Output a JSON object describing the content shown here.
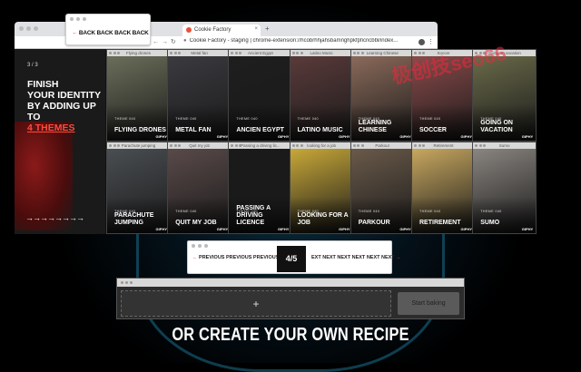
{
  "browser": {
    "tab_title": "Cookie Factory",
    "url": "Cookie Factory - staging | chrome-extension://hcobrhhjahsbamnghpkfpficncbbl/index...",
    "new_tab": "+",
    "tab_close": "×"
  },
  "back_window": {
    "label": "BACK BACK BACK BACK",
    "arrow": "←"
  },
  "intro": {
    "count": "3 / 3",
    "heading_line1": "FINISH",
    "heading_line2": "YOUR IDENTITY",
    "heading_line3": "BY ADDING UP",
    "heading_line4": "TO",
    "heading_accent": "4 THEMES",
    "arrows": "→→→→→→→→"
  },
  "tiles": [
    {
      "header": "Flying drones",
      "theme": "THEME 040",
      "name": "FLYING DRONES",
      "giphy": "GIPHY",
      "color": "#6b6e5a"
    },
    {
      "header": "Metal fan",
      "theme": "THEME 040",
      "name": "METAL FAN",
      "giphy": "GIPHY",
      "color": "#3b3a3f"
    },
    {
      "header": "Ancient Egypt",
      "theme": "THEME 040",
      "name": "ANCIEN EGYPT",
      "giphy": "GIPHY",
      "color": "#1e1e1e"
    },
    {
      "header": "Latino Music",
      "theme": "THEME 040",
      "name": "LATINO MUSIC",
      "giphy": "GIPHY",
      "color": "#5a3a3a"
    },
    {
      "header": "Learning Chinese",
      "theme": "THEME 040",
      "name": "LEARNING CHINESE",
      "giphy": "GIPHY",
      "color": "#8a6a5a"
    },
    {
      "header": "Soccer",
      "theme": "THEME 040",
      "name": "SOCCER",
      "giphy": "GIPHY",
      "color": "#8a4a4a"
    },
    {
      "header": "Going on vacation",
      "theme": "THEME 040",
      "name": "GOING ON VACATION",
      "giphy": "GIPHY",
      "color": "#6a6a4a"
    },
    {
      "header": "Parachute jumping",
      "theme": "THEME 040",
      "name": "PARACHUTE JUMPING",
      "giphy": "GIPHY",
      "color": "#4a4e52"
    },
    {
      "header": "Quit my job",
      "theme": "THEME 040",
      "name": "QUIT MY JOB",
      "giphy": "GIPHY",
      "color": "#5a4a4a"
    },
    {
      "header": "Passing a driving lic...",
      "theme": "THEME 040",
      "name": "PASSING A DRIVING LICENCE",
      "giphy": "GIPHY",
      "color": "#1a1a1a"
    },
    {
      "header": "looking for a job",
      "theme": "THEME 040",
      "name": "LOOKING FOR A JOB",
      "giphy": "GIPHY",
      "color": "#c8a838"
    },
    {
      "header": "Parkour",
      "theme": "THEME 040",
      "name": "PARKOUR",
      "giphy": "GIPHY",
      "color": "#6a5a4a"
    },
    {
      "header": "Retirement",
      "theme": "THEME 040",
      "name": "RETIREMENT",
      "giphy": "GIPHY",
      "color": "#c8a860"
    },
    {
      "header": "Sumo",
      "theme": "THEME 040",
      "name": "SUMO",
      "giphy": "GIPHY",
      "color": "#8a8580"
    }
  ],
  "pager": {
    "prev_label": "PREVIOUS PREVIOUS PREVIOUS",
    "prev_arrow": "←",
    "page": "4/5",
    "next_label": "EXT NEXT NEXT NEXT NEXT NEXT",
    "next_arrow": "→"
  },
  "recipe": {
    "plus": "+",
    "start_button": "Start baking"
  },
  "cta": "OR CREATE YOUR OWN RECIPE",
  "watermark": "极创技seo66"
}
